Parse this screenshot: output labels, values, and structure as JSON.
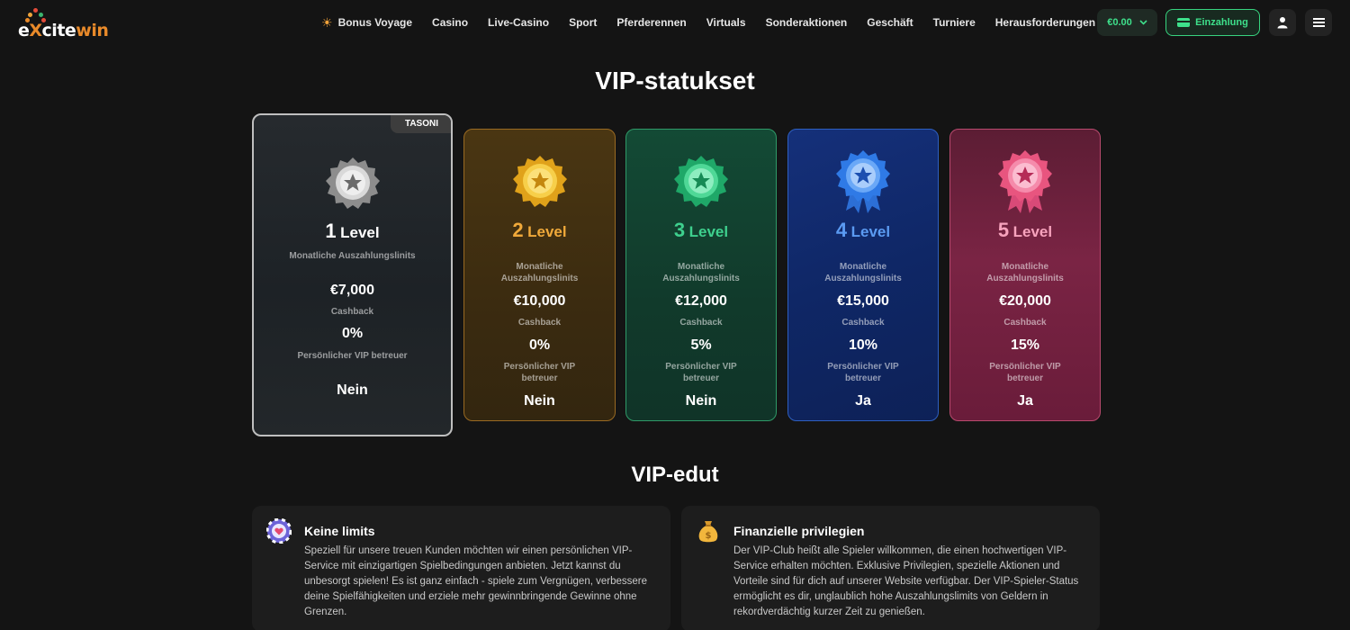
{
  "brand": {
    "name_part1": "e",
    "name_x": "X",
    "name_part2": "cite",
    "name_part3": "win"
  },
  "nav": {
    "items": [
      {
        "label": "Bonus Voyage",
        "icon": "sun-icon"
      },
      {
        "label": "Casino"
      },
      {
        "label": "Live-Casino"
      },
      {
        "label": "Sport"
      },
      {
        "label": "Pferderennen"
      },
      {
        "label": "Virtuals"
      },
      {
        "label": "Sonderaktionen"
      },
      {
        "label": "Geschäft"
      },
      {
        "label": "Turniere"
      },
      {
        "label": "Herausforderungen"
      }
    ]
  },
  "account": {
    "balance": "€0.00",
    "deposit_label": "Einzahlung"
  },
  "vip_section": {
    "title": "VIP-statukset",
    "current_tag": "TASONI",
    "labels": {
      "limits": "Monatliche Auszahlungslinits",
      "cashback": "Cashback",
      "manager": "Persönlicher VIP betreuer"
    },
    "level_word": "Level",
    "levels": [
      {
        "num": "1",
        "limit": "€7,000",
        "cashback": "0%",
        "manager": "Nein",
        "color": "#9a9a9a"
      },
      {
        "num": "2",
        "limit": "€10,000",
        "cashback": "0%",
        "manager": "Nein",
        "color": "#f0a93a"
      },
      {
        "num": "3",
        "limit": "€12,000",
        "cashback": "5%",
        "manager": "Nein",
        "color": "#3ed08e"
      },
      {
        "num": "4",
        "limit": "€15,000",
        "cashback": "10%",
        "manager": "Ja",
        "color": "#4a8ff0"
      },
      {
        "num": "5",
        "limit": "€20,000",
        "cashback": "15%",
        "manager": "Ja",
        "color": "#f0668e"
      }
    ]
  },
  "benefits_section": {
    "title": "VIP-edut",
    "items": [
      {
        "title": "Keine limits",
        "icon": "chip-heart-icon",
        "text": "Speziell für unsere treuen Kunden möchten wir einen persönlichen VIP-Service mit einzigartigen Spielbedingungen anbieten. Jetzt kannst du unbesorgt spielen! Es ist ganz einfach - spiele zum Vergnügen, verbessere deine Spielfähigkeiten und erziele mehr gewinnbringende Gewinne ohne Grenzen."
      },
      {
        "title": "Finanzielle privilegien",
        "icon": "money-bag-icon",
        "text": "Der VIP-Club heißt alle Spieler willkommen, die einen hochwertigen VIP-Service erhalten möchten. Exklusive Privilegien, spezielle Aktionen und Vorteile sind für dich auf unserer Website verfügbar. Der VIP-Spieler-Status ermöglicht es dir, unglaublich hohe Auszahlungslimits von Geldern in rekordverdächtig kurzer Zeit zu genießen."
      }
    ]
  }
}
